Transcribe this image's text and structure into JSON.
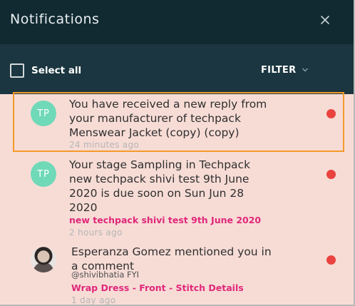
{
  "header": {
    "title": "Notifications",
    "close_icon": "close-icon"
  },
  "toolbar": {
    "select_all_label": "Select all",
    "filter_label": "FILTER",
    "filter_icon": "chevron-down-icon"
  },
  "colors": {
    "header_bg": "#112a32",
    "toolbar_bg": "#1b3640",
    "list_bg": "#f7dcd6",
    "avatar_bg": "#6fd9b8",
    "unread_dot": "#e9423f",
    "link_pink": "#e0287a",
    "focus_outline": "#f49a2a"
  },
  "notifications": [
    {
      "avatar_initials": "TP",
      "message_lines": [
        "You have received a new reply from",
        "your manufacturer of techpack",
        "Menswear Jacket (copy) (copy)"
      ],
      "time": "24 minutes ago",
      "unread": true
    },
    {
      "avatar_initials": "TP",
      "message_lines": [
        "Your stage Sampling in Techpack",
        "new techpack shivi test 9th June",
        "2020 is due soon on Sun Jun 28",
        "2020"
      ],
      "link": "new techpack shivi test 9th June 2020",
      "time": "2 hours ago",
      "unread": true
    },
    {
      "avatar": "user-photo",
      "message_lines": [
        "Esperanza Gomez mentioned you in",
        "a comment"
      ],
      "comment": "@shivibhatia FYI",
      "link": "Wrap Dress - Front - Stitch Details",
      "time": "1 day ago",
      "unread": true
    }
  ]
}
